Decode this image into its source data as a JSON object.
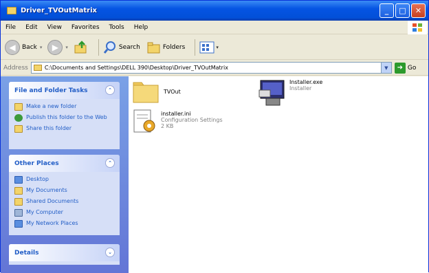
{
  "window": {
    "title": "Driver_TVOutMatrix"
  },
  "menu": [
    "File",
    "Edit",
    "View",
    "Favorites",
    "Tools",
    "Help"
  ],
  "toolbar": {
    "back": "Back",
    "search": "Search",
    "folders": "Folders"
  },
  "address": {
    "label": "Address",
    "value": "C:\\Documents and Settings\\DELL 390\\Desktop\\Driver_TVOutMatrix",
    "go": "Go"
  },
  "panels": {
    "tasks": {
      "title": "File and Folder Tasks",
      "items": [
        "Make a new folder",
        "Publish this folder to the Web",
        "Share this folder"
      ]
    },
    "places": {
      "title": "Other Places",
      "items": [
        "Desktop",
        "My Documents",
        "Shared Documents",
        "My Computer",
        "My Network Places"
      ]
    },
    "details": {
      "title": "Details"
    }
  },
  "files": [
    {
      "name": "TVOut",
      "type": "",
      "size": ""
    },
    {
      "name": "Installer.exe",
      "type": "Installer",
      "size": ""
    },
    {
      "name": "installer.ini",
      "type": "Configuration Settings",
      "size": "2 KB"
    }
  ]
}
